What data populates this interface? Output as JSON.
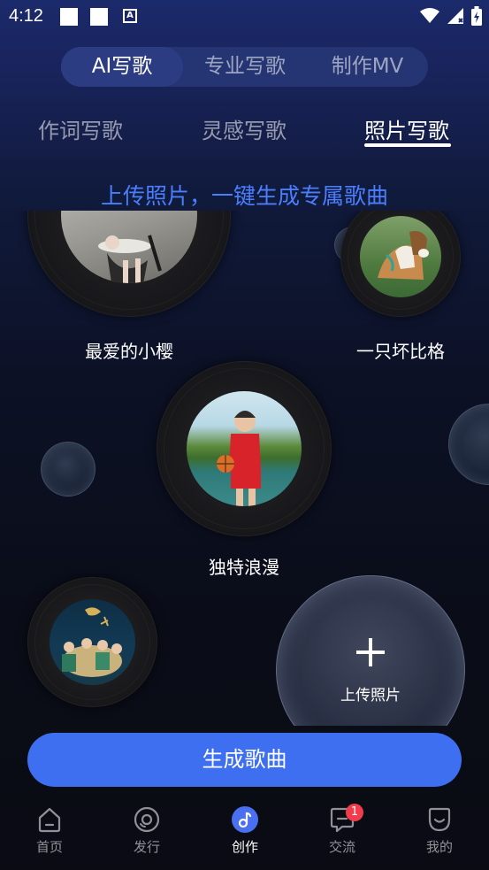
{
  "status_bar": {
    "time": "4:12"
  },
  "top_tabs": [
    "AI写歌",
    "专业写歌",
    "制作MV"
  ],
  "sub_tabs": [
    "作词写歌",
    "灵感写歌",
    "照片写歌"
  ],
  "headline": "上传照片，一键生成专属歌曲",
  "records": [
    {
      "label": "最爱的小樱"
    },
    {
      "label": "一只坏比格"
    },
    {
      "label": "独特浪漫"
    },
    {
      "label": ""
    }
  ],
  "upload": {
    "label": "上传照片"
  },
  "generate_button": "生成歌曲",
  "bottom_nav": [
    {
      "label": "首页"
    },
    {
      "label": "发行"
    },
    {
      "label": "创作"
    },
    {
      "label": "交流",
      "badge": "1"
    },
    {
      "label": "我的"
    }
  ]
}
